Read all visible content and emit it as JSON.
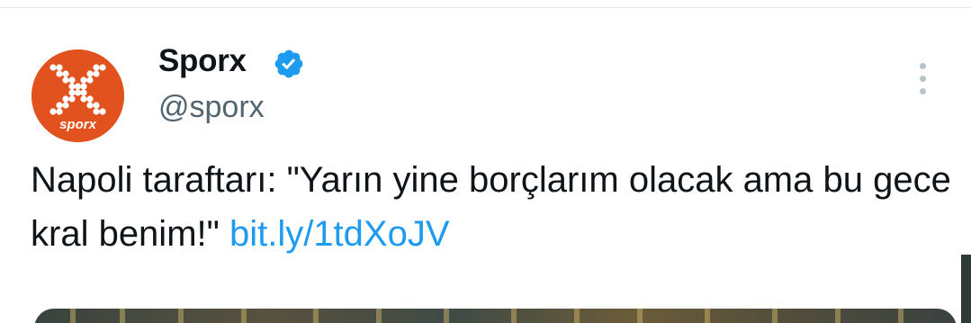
{
  "tweet": {
    "author": {
      "name": "Sporx",
      "handle": "@sporx",
      "verified": true,
      "avatar_label": "sporx",
      "avatar_color": "#e2521f"
    },
    "text": "Napoli taraftarı: \"Yarın yine borçlarım olacak ama bu gece kral benim!\"",
    "link": "bit.ly/1tdXoJV",
    "colors": {
      "text": "#0f1419",
      "handle": "#536471",
      "link": "#1d9bf0",
      "verified": "#1d9bf0"
    }
  },
  "icons": {
    "verified": "verified-badge-icon",
    "more": "more-options-icon"
  }
}
